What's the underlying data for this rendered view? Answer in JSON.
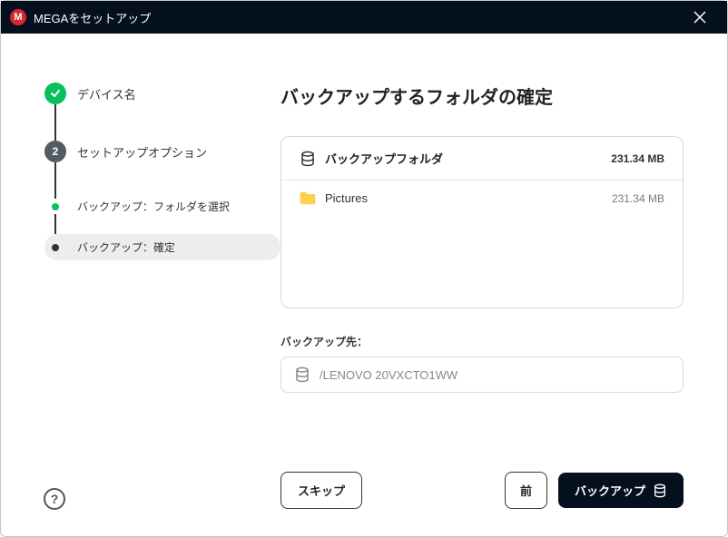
{
  "title": "MEGAをセットアップ",
  "steps": {
    "device": {
      "label": "デバイス名"
    },
    "setup": {
      "number": "2",
      "label": "セットアップオプション"
    },
    "sub_select": {
      "label": "バックアップ：フォルダを選択"
    },
    "sub_confirm": {
      "label": "バックアップ：確定"
    }
  },
  "main": {
    "heading": "バックアップするフォルダの確定",
    "folders_header": "バックアップフォルダ",
    "total_size": "231.34 MB",
    "items": [
      {
        "name": "Pictures",
        "size": "231.34 MB"
      }
    ],
    "dest_label": "バックアップ先：",
    "dest_path": "/LENOVO 20VXCTO1WW"
  },
  "footer": {
    "skip": "スキップ",
    "prev": "前",
    "primary": "バックアップ"
  }
}
